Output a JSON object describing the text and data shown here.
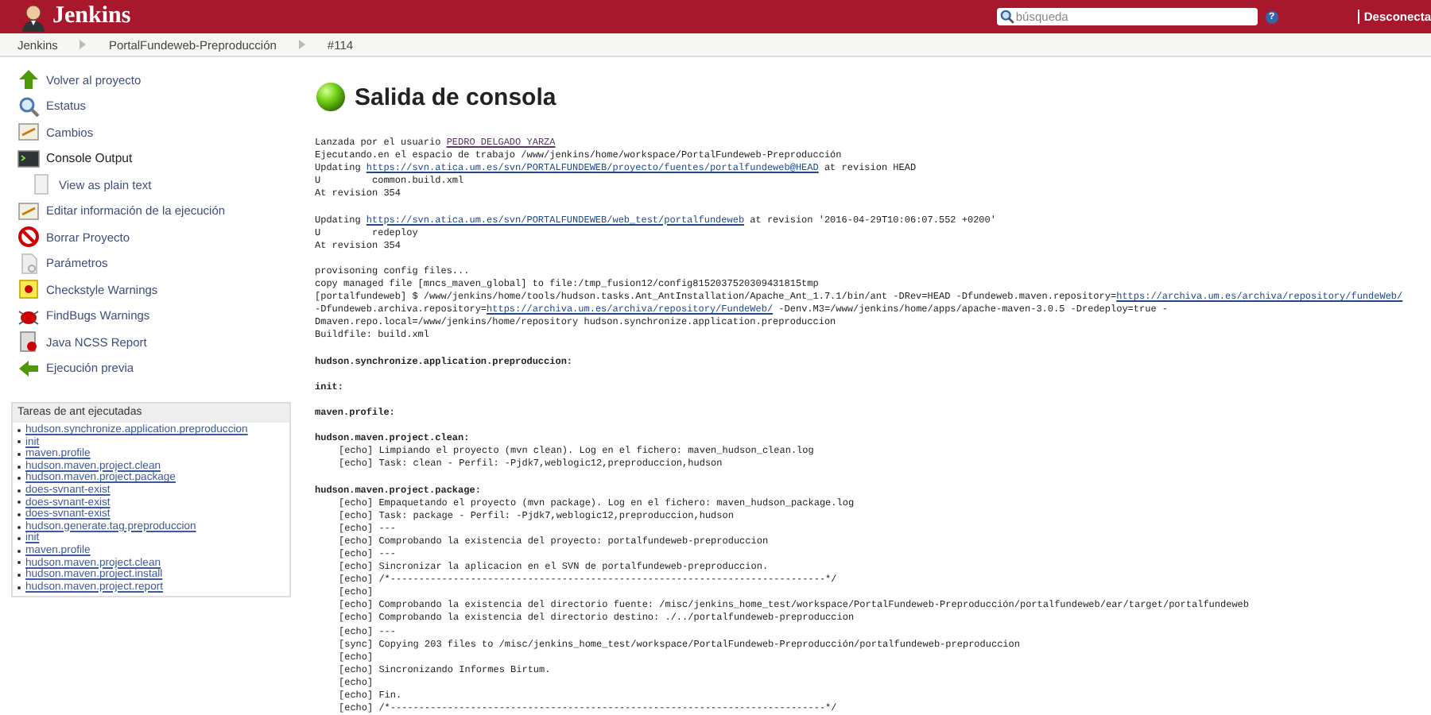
{
  "header": {
    "brand": "Jenkins",
    "search": {
      "placeholder": "búsqueda"
    },
    "help_icon": "?",
    "logout": "Desconecta"
  },
  "breadcrumbs": [
    "Jenkins",
    "PortalFundeweb-Preproducción",
    "#114"
  ],
  "sidebar": {
    "items": [
      {
        "label": "Volver al proyecto",
        "selected": false
      },
      {
        "label": "Estatus",
        "selected": false
      },
      {
        "label": "Cambios",
        "selected": false
      },
      {
        "label": "Console Output",
        "selected": true,
        "children": [
          {
            "label": "View as plain text",
            "selected": false
          }
        ]
      },
      {
        "label": "Editar información de la ejecución",
        "selected": false
      },
      {
        "label": "Borrar Proyecto",
        "selected": false
      },
      {
        "label": "Parámetros",
        "selected": false
      },
      {
        "label": "Checkstyle Warnings",
        "selected": false
      },
      {
        "label": "FindBugs Warnings",
        "selected": false
      },
      {
        "label": "Java NCSS Report",
        "selected": false
      },
      {
        "label": "Ejecución previa",
        "selected": false
      }
    ]
  },
  "tasks": {
    "title": "Tareas de ant ejecutadas",
    "items": [
      "hudson.synchronize.application.preproduccion",
      "init",
      "maven.profile",
      "hudson.maven.project.clean",
      "hudson.maven.project.package",
      "does-svnant-exist",
      "does-svnant-exist",
      "does-svnant-exist",
      "hudson.generate.tag.preproduccion",
      "init",
      "maven.profile",
      "hudson.maven.project.clean",
      "hudson.maven.project.install",
      "hudson.maven.project.report"
    ]
  },
  "title": "Salida de consola",
  "console": [
    {
      "kind": "link",
      "before": "Lanzada por el usuario ",
      "link": "PEDRO DELGADO YARZA",
      "visited": true
    },
    {
      "kind": "plain",
      "text": "Ejecutando.en el espacio de trabajo /www/jenkins/home/workspace/PortalFundeweb-Preproducción"
    },
    {
      "kind": "link",
      "before": "Updating ",
      "link": "https://svn.atica.um.es/svn/PORTALFUNDEWEB/proyecto/fuentes/portalfundeweb@HEAD",
      "after": " at revision HEAD",
      "visited": false
    },
    {
      "kind": "plain",
      "text": "U         common.build.xml"
    },
    {
      "kind": "plain",
      "text": "At revision 354"
    },
    {
      "kind": "blank"
    },
    {
      "kind": "link",
      "before": "Updating ",
      "link": "https://svn.atica.um.es/svn/PORTALFUNDEWEB/web_test/portalfundeweb",
      "after": " at revision '2016-04-29T10:06:07.552 +0200'",
      "visited": false
    },
    {
      "kind": "plain",
      "text": "U         redeploy"
    },
    {
      "kind": "plain",
      "text": "At revision 354"
    },
    {
      "kind": "blank"
    },
    {
      "kind": "plain",
      "text": "provisoning config files..."
    },
    {
      "kind": "plain",
      "text": "copy managed file [mncs_maven_global] to file:/tmp_fusion12/config8152037520309431815tmp"
    },
    {
      "kind": "link",
      "before": "[portalfundeweb] $ /www/jenkins/home/tools/hudson.tasks.Ant_AntInstallation/Apache_Ant_1.7.1/bin/ant -DRev=HEAD -Dfundeweb.maven.repository=",
      "link": "https://archiva.um.es/archiva/repository/fundeWeb/",
      "visited": false
    },
    {
      "kind": "link",
      "before": "-Dfundeweb.archiva.repository=",
      "link": "https://archiva.um.es/archiva/repository/FundeWeb/",
      "after": " -Denv.M3=/www/jenkins/home/apps/apache-maven-3.0.5 -Dredeploy=true -",
      "visited": false
    },
    {
      "kind": "plain",
      "text": "Dmaven.repo.local=/www/jenkins/home/repository hudson.synchronize.application.preproduccion"
    },
    {
      "kind": "plain",
      "text": "Buildfile: build.xml"
    },
    {
      "kind": "blank"
    },
    {
      "kind": "target",
      "text": "hudson.synchronize.application.preproduccion:"
    },
    {
      "kind": "blank"
    },
    {
      "kind": "target",
      "text": "init:"
    },
    {
      "kind": "blank"
    },
    {
      "kind": "target",
      "text": "maven.profile:"
    },
    {
      "kind": "blank"
    },
    {
      "kind": "target",
      "text": "hudson.maven.project.clean:"
    },
    {
      "kind": "indented",
      "text": "[echo] Limpiando el proyecto (mvn clean). Log en el fichero: maven_hudson_clean.log"
    },
    {
      "kind": "indented",
      "text": "[echo] Task: clean - Perfil: -Pjdk7,weblogic12,preproduccion,hudson"
    },
    {
      "kind": "blank"
    },
    {
      "kind": "target",
      "text": "hudson.maven.project.package:"
    },
    {
      "kind": "indented",
      "text": "[echo] Empaquetando el proyecto (mvn package). Log en el fichero: maven_hudson_package.log"
    },
    {
      "kind": "indented",
      "text": "[echo] Task: package - Perfil: -Pjdk7,weblogic12,preproduccion,hudson"
    },
    {
      "kind": "indented",
      "text": "[echo] ---"
    },
    {
      "kind": "indented",
      "text": "[echo] Comprobando la existencia del proyecto: portalfundeweb-preproduccion"
    },
    {
      "kind": "indented",
      "text": "[echo] ---"
    },
    {
      "kind": "indented",
      "text": "[echo] Sincronizar la aplicacion en el SVN de portalfundeweb-preproduccion."
    },
    {
      "kind": "indented",
      "text": "[echo] /*----------------------------------------------------------------------------*/"
    },
    {
      "kind": "indented",
      "text": "[echo]"
    },
    {
      "kind": "indented",
      "text": "[echo] Comprobando la existencia del directorio fuente: /misc/jenkins_home_test/workspace/PortalFundeweb-Preproducción/portalfundeweb/ear/target/portalfundeweb"
    },
    {
      "kind": "indented",
      "text": "[echo] Comprobando la existencia del directorio destino: ./../portalfundeweb-preproduccion"
    },
    {
      "kind": "indented",
      "text": "[echo] ---"
    },
    {
      "kind": "indented",
      "text": "[sync] Copying 203 files to /misc/jenkins_home_test/workspace/PortalFundeweb-Preproducción/portalfundeweb-preproduccion"
    },
    {
      "kind": "indented",
      "text": "[echo]"
    },
    {
      "kind": "indented",
      "text": "[echo] Sincronizando Informes Birtum."
    },
    {
      "kind": "indented",
      "text": "[echo]"
    },
    {
      "kind": "indented",
      "text": "[echo] Fin."
    },
    {
      "kind": "indented",
      "text": "[echo] /*----------------------------------------------------------------------------*/"
    }
  ]
}
